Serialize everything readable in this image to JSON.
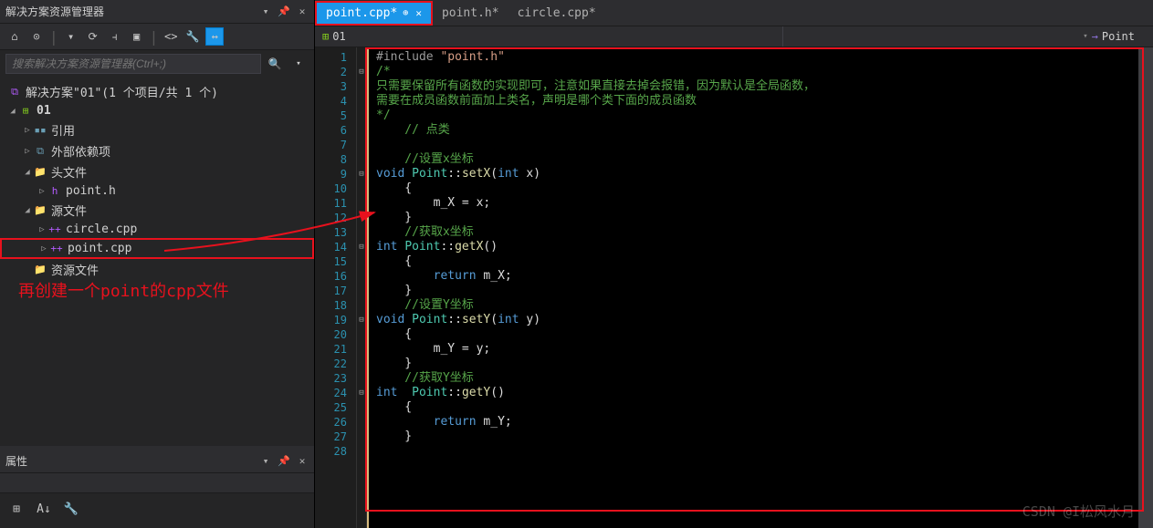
{
  "solution_explorer": {
    "title": "解决方案资源管理器",
    "search_placeholder": "搜索解决方案资源管理器(Ctrl+;)",
    "solution_label": "解决方案\"01\"(1 个项目/共 1 个)",
    "tree": {
      "project": "01",
      "refs": "引用",
      "external": "外部依赖项",
      "headers": "头文件",
      "headers_children": [
        "point.h"
      ],
      "sources": "源文件",
      "sources_children": [
        "circle.cpp",
        "point.cpp"
      ],
      "resources": "资源文件"
    }
  },
  "properties_panel": {
    "title": "属性"
  },
  "tabs": {
    "items": [
      {
        "label": "point.cpp*",
        "active": true
      },
      {
        "label": "point.h*",
        "active": false
      },
      {
        "label": "circle.cpp*",
        "active": false
      }
    ]
  },
  "nav": {
    "project": "01",
    "member": "Point"
  },
  "annotation": "再创建一个point的cpp文件",
  "watermark": "CSDN @I松风水月",
  "code_lines": [
    {
      "n": 1,
      "tokens": [
        {
          "t": "#include ",
          "c": "c-pre"
        },
        {
          "t": "\"point.h\"",
          "c": "c-str"
        }
      ]
    },
    {
      "n": 2,
      "tokens": [
        {
          "t": "/*",
          "c": "c-cmt"
        }
      ],
      "fold": "⊟"
    },
    {
      "n": 3,
      "tokens": [
        {
          "t": "只需要保留所有函数的实现即可，注意如果直接去掉会报错，因为默认是全局函数，",
          "c": "c-cmt"
        }
      ]
    },
    {
      "n": 4,
      "tokens": [
        {
          "t": "需要在成员函数前面加上类名，声明是哪个类下面的成员函数",
          "c": "c-cmt"
        }
      ]
    },
    {
      "n": 5,
      "tokens": [
        {
          "t": "*/",
          "c": "c-cmt"
        }
      ]
    },
    {
      "n": 6,
      "tokens": [
        {
          "t": "    // 点类",
          "c": "c-cmt"
        }
      ]
    },
    {
      "n": 7,
      "tokens": []
    },
    {
      "n": 8,
      "tokens": [
        {
          "t": "    //设置x坐标",
          "c": "c-cmt"
        }
      ]
    },
    {
      "n": 9,
      "tokens": [
        {
          "t": "void ",
          "c": "c-kw"
        },
        {
          "t": "Point",
          "c": "c-cls"
        },
        {
          "t": "::",
          "c": ""
        },
        {
          "t": "setX",
          "c": "c-fn"
        },
        {
          "t": "(",
          "c": ""
        },
        {
          "t": "int",
          "c": "c-kw"
        },
        {
          "t": " x)",
          "c": ""
        }
      ],
      "fold": "⊟"
    },
    {
      "n": 10,
      "tokens": [
        {
          "t": "    {",
          "c": ""
        }
      ]
    },
    {
      "n": 11,
      "tokens": [
        {
          "t": "        m_X = x;",
          "c": ""
        }
      ]
    },
    {
      "n": 12,
      "tokens": [
        {
          "t": "    }",
          "c": ""
        }
      ]
    },
    {
      "n": 13,
      "tokens": [
        {
          "t": "    //获取x坐标",
          "c": "c-cmt"
        }
      ]
    },
    {
      "n": 14,
      "tokens": [
        {
          "t": "int ",
          "c": "c-kw"
        },
        {
          "t": "Point",
          "c": "c-cls"
        },
        {
          "t": "::",
          "c": ""
        },
        {
          "t": "getX",
          "c": "c-fn"
        },
        {
          "t": "()",
          "c": ""
        }
      ],
      "fold": "⊟"
    },
    {
      "n": 15,
      "tokens": [
        {
          "t": "    {",
          "c": ""
        }
      ]
    },
    {
      "n": 16,
      "tokens": [
        {
          "t": "        ",
          "c": ""
        },
        {
          "t": "return",
          "c": "c-kw"
        },
        {
          "t": " m_X;",
          "c": ""
        }
      ]
    },
    {
      "n": 17,
      "tokens": [
        {
          "t": "    }",
          "c": ""
        }
      ]
    },
    {
      "n": 18,
      "tokens": [
        {
          "t": "    //设置Y坐标",
          "c": "c-cmt"
        }
      ]
    },
    {
      "n": 19,
      "tokens": [
        {
          "t": "void ",
          "c": "c-kw"
        },
        {
          "t": "Point",
          "c": "c-cls"
        },
        {
          "t": "::",
          "c": ""
        },
        {
          "t": "setY",
          "c": "c-fn"
        },
        {
          "t": "(",
          "c": ""
        },
        {
          "t": "int",
          "c": "c-kw"
        },
        {
          "t": " y)",
          "c": ""
        }
      ],
      "fold": "⊟"
    },
    {
      "n": 20,
      "tokens": [
        {
          "t": "    {",
          "c": ""
        }
      ]
    },
    {
      "n": 21,
      "tokens": [
        {
          "t": "        m_Y = y;",
          "c": ""
        }
      ]
    },
    {
      "n": 22,
      "tokens": [
        {
          "t": "    }",
          "c": ""
        }
      ]
    },
    {
      "n": 23,
      "tokens": [
        {
          "t": "    //获取Y坐标",
          "c": "c-cmt"
        }
      ]
    },
    {
      "n": 24,
      "tokens": [
        {
          "t": "int  ",
          "c": "c-kw"
        },
        {
          "t": "Point",
          "c": "c-cls"
        },
        {
          "t": "::",
          "c": ""
        },
        {
          "t": "getY",
          "c": "c-fn"
        },
        {
          "t": "()",
          "c": ""
        }
      ],
      "fold": "⊟"
    },
    {
      "n": 25,
      "tokens": [
        {
          "t": "    {",
          "c": ""
        }
      ]
    },
    {
      "n": 26,
      "tokens": [
        {
          "t": "        ",
          "c": ""
        },
        {
          "t": "return",
          "c": "c-kw"
        },
        {
          "t": " m_Y;",
          "c": ""
        }
      ]
    },
    {
      "n": 27,
      "tokens": [
        {
          "t": "    }",
          "c": ""
        }
      ]
    },
    {
      "n": 28,
      "tokens": []
    }
  ]
}
